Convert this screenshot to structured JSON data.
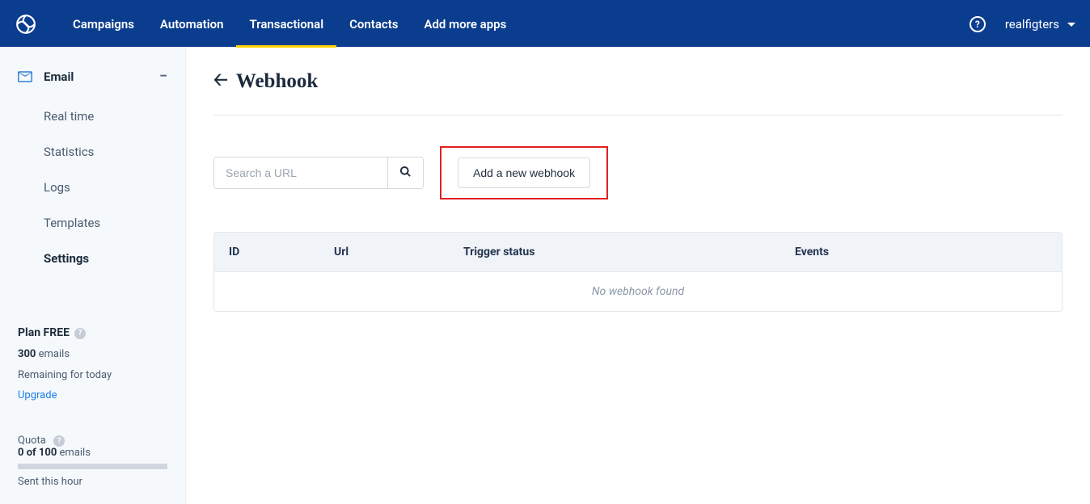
{
  "nav": {
    "items": [
      {
        "label": "Campaigns"
      },
      {
        "label": "Automation"
      },
      {
        "label": "Transactional"
      },
      {
        "label": "Contacts"
      },
      {
        "label": "Add more apps"
      }
    ],
    "user": "realfigters"
  },
  "sidebar": {
    "section_label": "Email",
    "items": [
      {
        "label": "Real time"
      },
      {
        "label": "Statistics"
      },
      {
        "label": "Logs"
      },
      {
        "label": "Templates"
      },
      {
        "label": "Settings"
      }
    ]
  },
  "plan": {
    "title": "Plan FREE",
    "emails_count": "300",
    "emails_word": "emails",
    "remaining": "Remaining for today",
    "upgrade": "Upgrade"
  },
  "quota": {
    "title": "Quota",
    "count": "0 of 100",
    "emails_word": "emails",
    "sent": "Sent this hour"
  },
  "page": {
    "title": "Webhook"
  },
  "search": {
    "placeholder": "Search a URL"
  },
  "actions": {
    "add_label": "Add a new webhook"
  },
  "table": {
    "headers": {
      "id": "ID",
      "url": "Url",
      "trigger": "Trigger status",
      "events": "Events"
    },
    "empty": "No webhook found"
  }
}
